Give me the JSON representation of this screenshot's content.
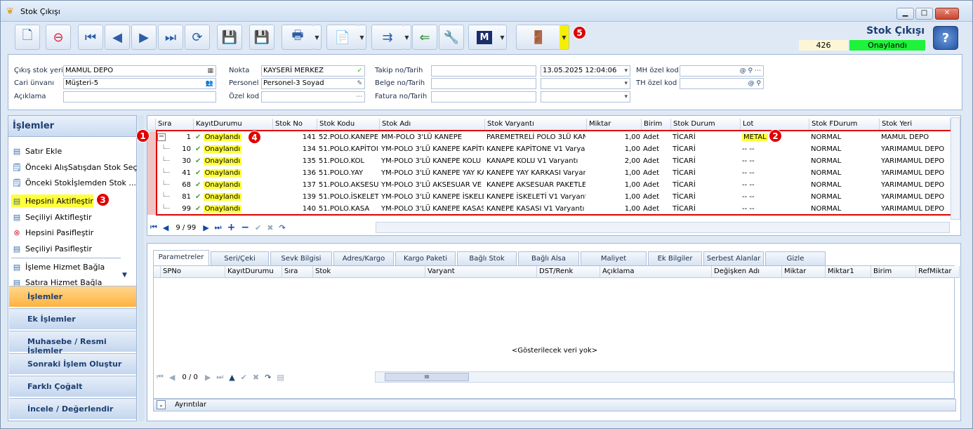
{
  "window": {
    "title": "Stok Çıkışı"
  },
  "header": {
    "title": "Stok Çıkışı",
    "doc_no": "426",
    "status": "Onaylandı",
    "status_color": "#1df33a"
  },
  "toolbar": {
    "m_button": "M"
  },
  "annotations": {
    "a1": "1",
    "a2": "2",
    "a3": "3",
    "a4": "4",
    "a5": "5"
  },
  "form": {
    "cikis_stok_yeri_label": "Çıkış stok yeri",
    "cikis_stok_yeri": "MAMUL DEPO",
    "cari_unvani_label": "Cari ünvanı",
    "cari_unvani": "Müşteri-5",
    "aciklama_label": "Açıklama",
    "aciklama": "",
    "nokta_label": "Nokta",
    "nokta": "KAYSERİ MERKEZ",
    "personel_label": "Personel",
    "personel": "Personel-3 Soyad",
    "ozel_kod_label": "Özel kod",
    "ozel_kod": "",
    "takip_label": "Takip no/Tarih",
    "takip_no": "",
    "takip_tarih": "13.05.2025 12:04:06",
    "belge_label": "Belge no/Tarih",
    "belge_no": "",
    "belge_tarih": "",
    "fatura_label": "Fatura no/Tarih",
    "fatura_no": "",
    "fatura_tarih": "",
    "mh_label": "MH özel kod",
    "mh_value": "",
    "th_label": "TH özel kod",
    "th_value": ""
  },
  "left_panel": {
    "title": "İşlemler",
    "items": [
      "Satır Ekle",
      "Önceki AlışSatışdan Stok Seç",
      "Önceki Stokİşlemden Stok ...",
      "Hepsini Aktifleştir",
      "Seçiliyi Aktifleştir",
      "Hepsini Pasifleştir",
      "Seçiliyi Pasifleştir",
      "İşleme Hizmet Bağla",
      "Satıra Hizmet Bağla"
    ],
    "nav": [
      "İşlemler",
      "Ek İşlemler",
      "Muhasebe / Resmi İşlemler",
      "Sonraki İşlem Oluştur",
      "Farklı Çoğalt",
      "İncele / Değerlendir"
    ]
  },
  "grid": {
    "columns": [
      "Sıra",
      "KayıtDurumu",
      "Stok No",
      "Stok Kodu",
      "Stok Adı",
      "Stok Varyantı",
      "Miktar",
      "Birim",
      "Stok Durum",
      "Lot",
      "Stok FDurum",
      "Stok Yeri"
    ],
    "rows": [
      {
        "sira": "1",
        "durum": "Onaylandı",
        "stokno": "141",
        "kodu": "52.POLO.KANEPE",
        "adi": "MM-POLO 3'LÜ KANEPE",
        "varyant": "PAREMETRELİ POLO 3LÜ KAN",
        "miktar": "1,00",
        "birim": "Adet",
        "sdurum": "TİCARİ",
        "lot": "METAL",
        "fdurum": "NORMAL",
        "yeri": "MAMUL DEPO"
      },
      {
        "sira": "10",
        "durum": "Onaylandı",
        "stokno": "134",
        "kodu": "51.POLO.KAPİTOI",
        "adi": "YM-POLO 3'LÜ KANEPE KAPİTO",
        "varyant": "KANEPE KAPİTONE V1 Varyant",
        "miktar": "1,00",
        "birim": "Adet",
        "sdurum": "TİCARİ",
        "lot": "-- --",
        "fdurum": "NORMAL",
        "yeri": "YARIMAMUL DEPO"
      },
      {
        "sira": "30",
        "durum": "Onaylandı",
        "stokno": "135",
        "kodu": "51.POLO.KOL",
        "adi": "YM-POLO 3'LÜ KANEPE KOLU",
        "varyant": "KANAPE KOLU V1 Varyantı",
        "miktar": "2,00",
        "birim": "Adet",
        "sdurum": "TİCARİ",
        "lot": "-- --",
        "fdurum": "NORMAL",
        "yeri": "YARIMAMUL DEPO"
      },
      {
        "sira": "41",
        "durum": "Onaylandı",
        "stokno": "136",
        "kodu": "51.POLO.YAY",
        "adi": "YM-POLO 3'LÜ KANEPE YAY KA",
        "varyant": "KANEPE YAY KARKASI Varyar",
        "miktar": "1,00",
        "birim": "Adet",
        "sdurum": "TİCARİ",
        "lot": "-- --",
        "fdurum": "NORMAL",
        "yeri": "YARIMAMUL DEPO"
      },
      {
        "sira": "68",
        "durum": "Onaylandı",
        "stokno": "137",
        "kodu": "51.POLO.AKSESU.",
        "adi": "YM-POLO 3'LÜ AKSESUAR VE P",
        "varyant": "KANEPE AKSESUAR PAKETLEI",
        "miktar": "1,00",
        "birim": "Adet",
        "sdurum": "TİCARİ",
        "lot": "-- --",
        "fdurum": "NORMAL",
        "yeri": "YARIMAMUL DEPO"
      },
      {
        "sira": "81",
        "durum": "Onaylandı",
        "stokno": "139",
        "kodu": "51.POLO.İSKELET",
        "adi": "YM-POLO 3'LÜ KANEPE İSKELE",
        "varyant": "KANEPE İSKELETİ V1 Varyantı",
        "miktar": "1,00",
        "birim": "Adet",
        "sdurum": "TİCARİ",
        "lot": "-- --",
        "fdurum": "NORMAL",
        "yeri": "YARIMAMUL DEPO"
      },
      {
        "sira": "99",
        "durum": "Onaylandı",
        "stokno": "140",
        "kodu": "51.POLO.KASA",
        "adi": "YM-POLO 3'LÜ KANEPE KASASI",
        "varyant": "KANEPE KASASI V1 Varyantı",
        "miktar": "1,00",
        "birim": "Adet",
        "sdurum": "TİCARİ",
        "lot": "-- --",
        "fdurum": "NORMAL",
        "yeri": "YARIMAMUL DEPO"
      }
    ],
    "pager": "9 / 99"
  },
  "detail": {
    "tabs": [
      "Parametreler",
      "Seri/Çeki",
      "Sevk Bilgisi",
      "Adres/Kargo",
      "Kargo Paketi",
      "Bağlı Stok",
      "Bağlı Alsa",
      "Maliyet",
      "Ek Bilgiler",
      "Serbest Alanlar",
      "Gizle"
    ],
    "columns": [
      "SPNo",
      "KayıtDurumu",
      "Sıra",
      "Stok",
      "Varyant",
      "DST/Renk",
      "Açıklama",
      "Değişken Adı",
      "Miktar",
      "Miktar1",
      "Birim",
      "RefMiktar"
    ],
    "empty": "<Gösterilecek veri yok>",
    "pager": "0 / 0",
    "scroll_grip": "III",
    "footer": "Ayrıntılar"
  }
}
